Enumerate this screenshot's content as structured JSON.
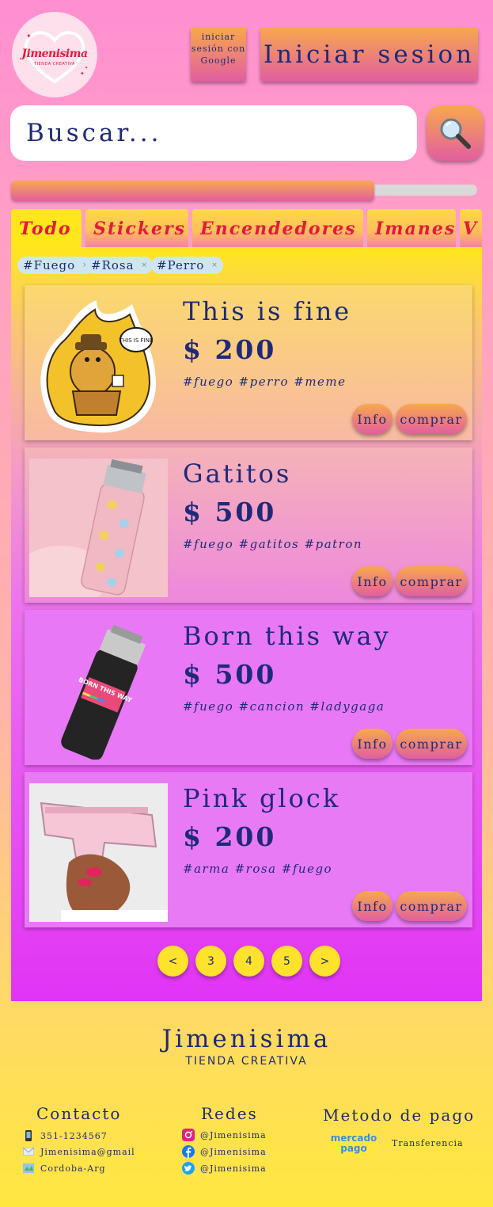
{
  "brand": {
    "logo_name": "Jimenisima",
    "logo_sub": "TIENDA CREATIVA"
  },
  "header": {
    "google_login_label": "iniciar sesión con Google",
    "login_label": "Iniciar sesion"
  },
  "search": {
    "placeholder": "Buscar..."
  },
  "progress": {
    "value_fraction": 0.78
  },
  "tabs": [
    {
      "label": "Todo",
      "active": true
    },
    {
      "label": "Stickers",
      "active": false
    },
    {
      "label": "Encendedores",
      "active": false
    },
    {
      "label": "Imanes",
      "active": false
    },
    {
      "label": "V",
      "active": false
    }
  ],
  "filters": [
    "#Fuego",
    "#Rosa",
    "#Perro"
  ],
  "filter_remove_glyph": "×",
  "products": [
    {
      "title": "This is fine",
      "price": "$ 200",
      "tags": "#fuego #perro #meme",
      "info": "Info",
      "buy": "comprar"
    },
    {
      "title": "Gatitos",
      "price": "$ 500",
      "tags": "#fuego #gatitos #patron",
      "info": "Info",
      "buy": "comprar"
    },
    {
      "title": "Born this way",
      "price": "$ 500",
      "tags": "#fuego #cancion #ladygaga",
      "info": "Info",
      "buy": "comprar"
    },
    {
      "title": "Pink glock",
      "price": "$ 200",
      "tags": "#arma #rosa #fuego",
      "info": "Info",
      "buy": "comprar"
    }
  ],
  "sticker_bubble": "THIS IS FINE",
  "lighter_text": "BORN THIS WAY",
  "pagination": [
    "<",
    "3",
    "4",
    "5",
    ">"
  ],
  "footer": {
    "brand": "Jimenisima",
    "subtitle": "TIENDA CREATIVA",
    "contact": {
      "title": "Contacto",
      "phone": "351-1234567",
      "email": "Jimenisima@gmail",
      "location": "Cordoba-Arg"
    },
    "social": {
      "title": "Redes",
      "instagram": "@Jimenisima",
      "facebook": "@Jimenisima",
      "twitter": "@Jimenisima"
    },
    "payment": {
      "title": "Metodo de pago",
      "mercado_pago": "mercado pago",
      "transfer": "Transferencia"
    }
  },
  "icons": {
    "search": "magnifier-icon",
    "phone": "phone-icon",
    "mail": "mail-icon",
    "map": "map-icon",
    "instagram": "instagram-icon",
    "facebook": "facebook-icon",
    "twitter": "twitter-icon"
  },
  "colors": {
    "text": "#1e2a78",
    "tab_text": "#e3193e",
    "button_top": "#f7a94c",
    "button_bottom": "#e25ea0",
    "pager": "#ffe22c"
  }
}
